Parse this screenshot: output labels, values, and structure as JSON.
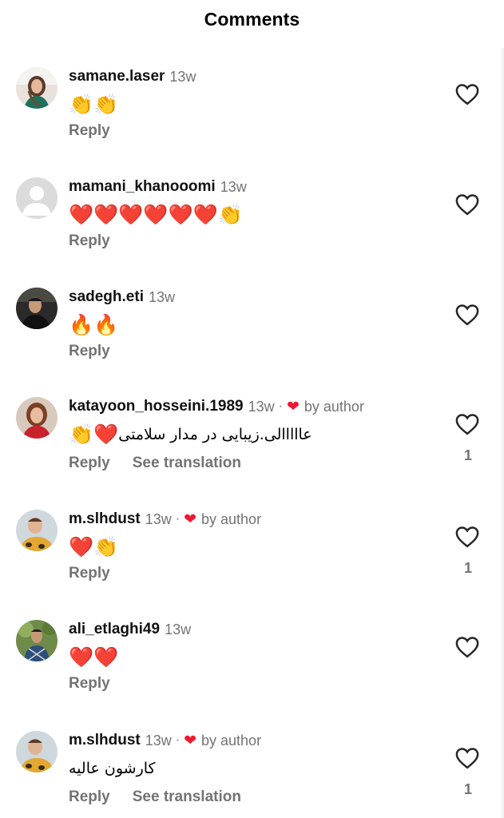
{
  "header": {
    "title": "Comments"
  },
  "comments": [
    {
      "username": "samane.laser",
      "time": "13w",
      "text": "👏👏",
      "reply": "Reply"
    },
    {
      "username": "mamani_khanooomi",
      "time": "13w",
      "text": "❤️❤️❤️❤️❤️❤️👏",
      "reply": "Reply"
    },
    {
      "username": "sadegh.eti",
      "time": "13w",
      "text": "🔥🔥",
      "reply": "Reply"
    },
    {
      "username": "katayoon_hosseini.1989",
      "time": "13w",
      "dot": "·",
      "author_heart": "❤",
      "by_author": "by author",
      "text_rtl": "عااااالی.زیبایی در مدار سلامتی",
      "emoji": "👏❤️",
      "reply": "Reply",
      "translate": "See translation",
      "likes": "1"
    },
    {
      "username": "m.slhdust",
      "time": "13w",
      "dot": "·",
      "author_heart": "❤",
      "by_author": "by author",
      "text": "❤️👏",
      "reply": "Reply",
      "likes": "1"
    },
    {
      "username": "ali_etlaghi49",
      "time": "13w",
      "text": "❤️❤️",
      "reply": "Reply"
    },
    {
      "username": "m.slhdust",
      "time": "13w",
      "dot": "·",
      "author_heart": "❤",
      "by_author": "by author",
      "text_rtl": "کارشون عالیه",
      "reply": "Reply",
      "translate": "See translation",
      "likes": "1"
    }
  ],
  "icons": {
    "like": "heart-outline-icon",
    "author_like": "heart-filled-icon"
  },
  "colors": {
    "secondary_text": "#737373",
    "author_heart": "#f0182f",
    "username": "#111111"
  }
}
